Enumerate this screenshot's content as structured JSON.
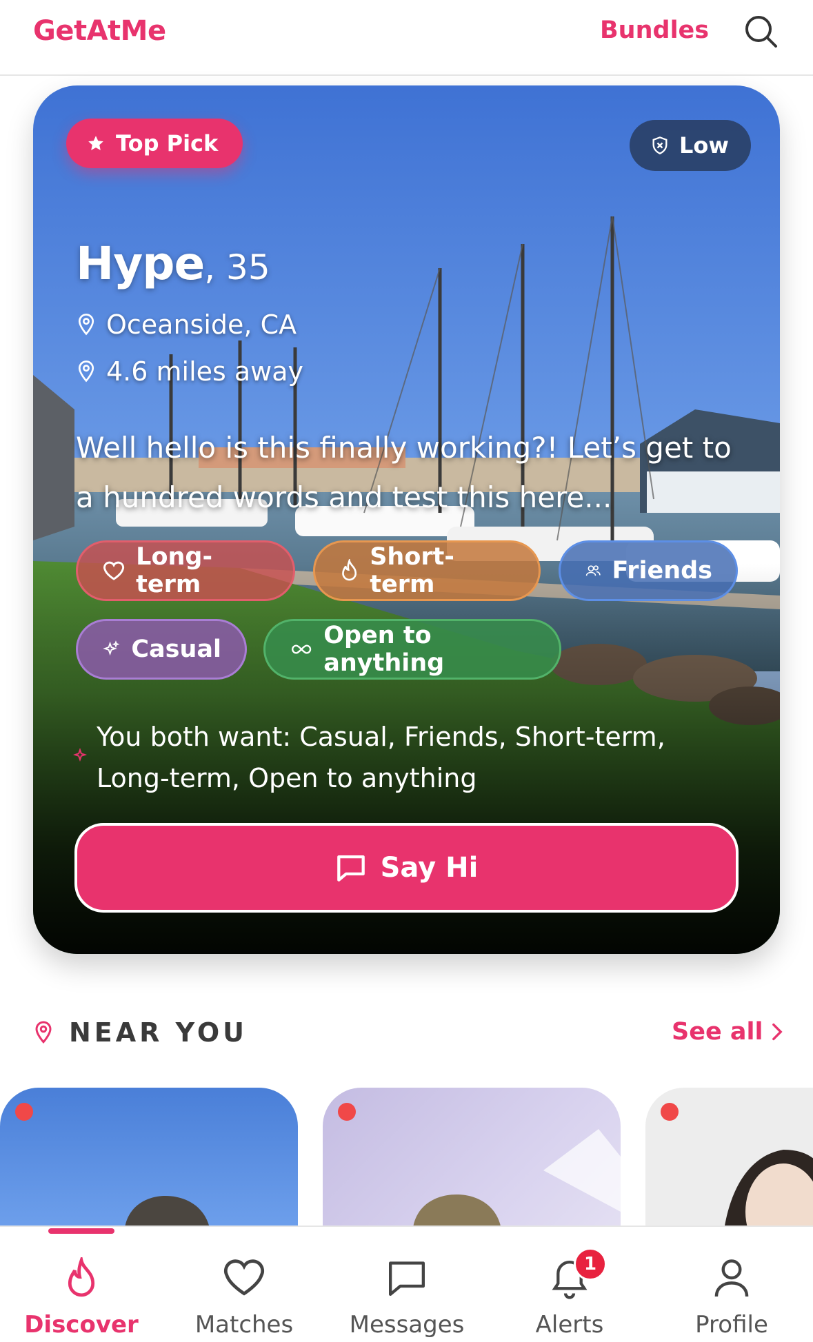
{
  "app": {
    "logo": "GetAtMe",
    "bundles_label": "Bundles"
  },
  "hero": {
    "top_pick_label": "Top Pick",
    "risk_label": "Low",
    "name": "Hype",
    "age": ", 35",
    "location": "Oceanside, CA",
    "distance": "4.6 miles away",
    "bio": "Well hello is this finally working?! Let’s get to a hundred words and test this here...",
    "tags": {
      "longterm": "Long-term",
      "shortterm": "Short-term",
      "friends": "Friends",
      "casual": "Casual",
      "open": "Open to anything"
    },
    "both_want": "You both want: Casual, Friends, Short-term, Long-term, Open to anything",
    "say_hi_label": "Say Hi"
  },
  "near_you": {
    "title": "NEAR YOU",
    "see_all": "See all"
  },
  "nav": {
    "items": [
      {
        "label": "Discover",
        "icon": "flame-icon"
      },
      {
        "label": "Matches",
        "icon": "heart-icon"
      },
      {
        "label": "Messages",
        "icon": "message-icon"
      },
      {
        "label": "Alerts",
        "icon": "bell-icon",
        "badge": "1"
      },
      {
        "label": "Profile",
        "icon": "user-icon"
      }
    ]
  },
  "colors": {
    "brand": "#e8336d",
    "badge": "#e8223f"
  }
}
